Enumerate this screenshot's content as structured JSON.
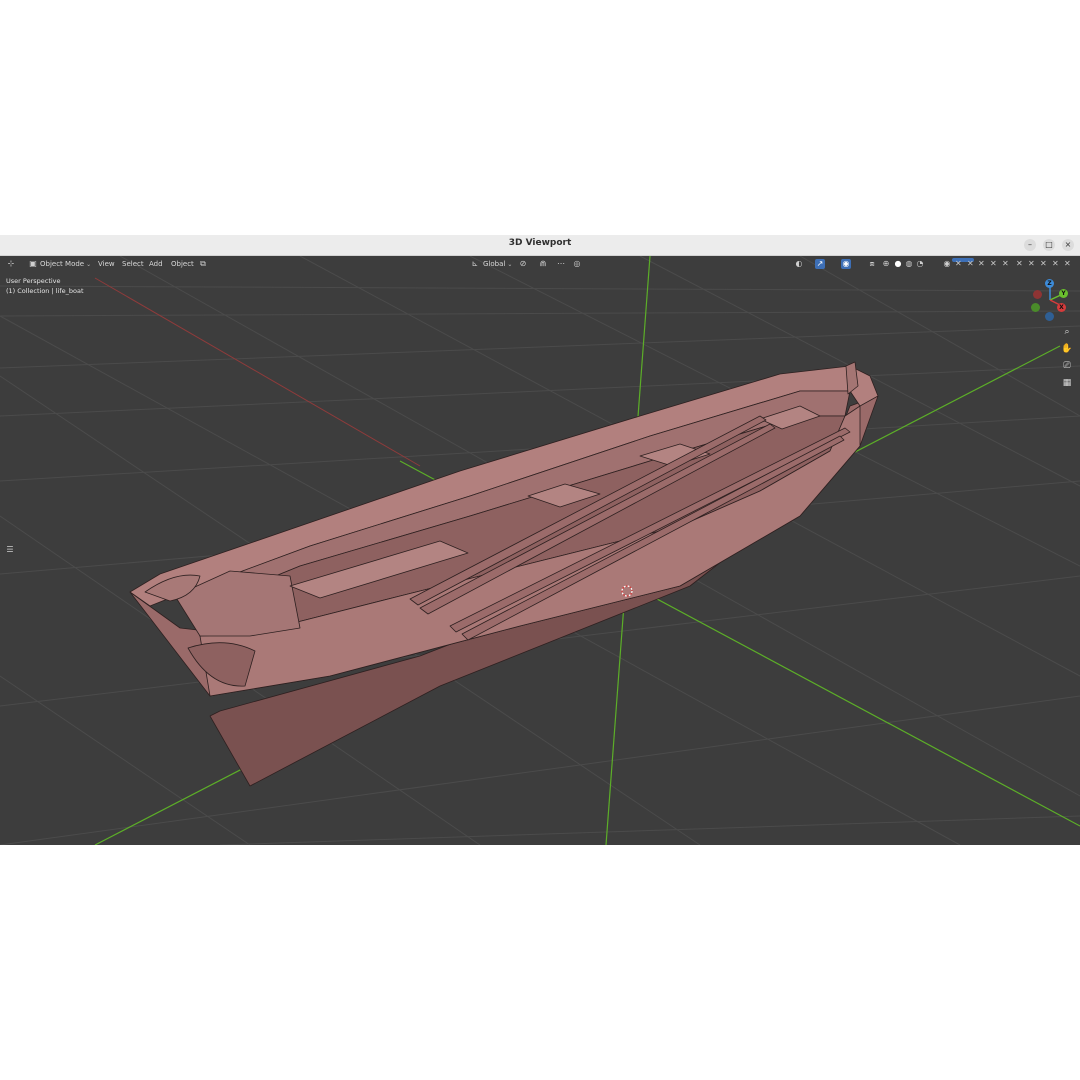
{
  "window": {
    "title": "3D Viewport",
    "controls": {
      "minimize": "–",
      "maximize": "□",
      "close": "×"
    }
  },
  "header": {
    "editor_type_icon": "axes-icon",
    "mode_icon": "object-mode-icon",
    "mode": "Object Mode",
    "menus": [
      "View",
      "Select",
      "Add",
      "Object"
    ],
    "transform_orientation": "Global",
    "icons": {
      "pivot": "pivot-icon",
      "snap": "snap-icon",
      "proportional": "proportional-edit-icon",
      "visibility": "visibility-icon",
      "gizmo": "gizmo-icon",
      "overlay": "overlay-icon",
      "xray": "xray-icon",
      "shading": [
        "wireframe-icon",
        "solid-icon",
        "material-icon",
        "rendered-icon"
      ]
    }
  },
  "overlay": {
    "view_name": "User Perspective",
    "collection": "(1) Collection | life_boat"
  },
  "gizmo": {
    "z": "Z",
    "y": "Y",
    "x": "X"
  },
  "nav_buttons": [
    "zoom-icon",
    "pan-hand-icon",
    "camera-icon",
    "grid-icon"
  ],
  "side_toggle": "tool-shelf-icon",
  "colors": {
    "viewport_bg": "#3d3d3d",
    "grid": "#4a4a4a",
    "y_axis": "#6ac02e",
    "x_axis": "#b84a4a",
    "hull": "#9c6d6c",
    "hull_light": "#b07f7d",
    "hull_dark": "#7d5452",
    "edge": "#2a1e1e"
  }
}
